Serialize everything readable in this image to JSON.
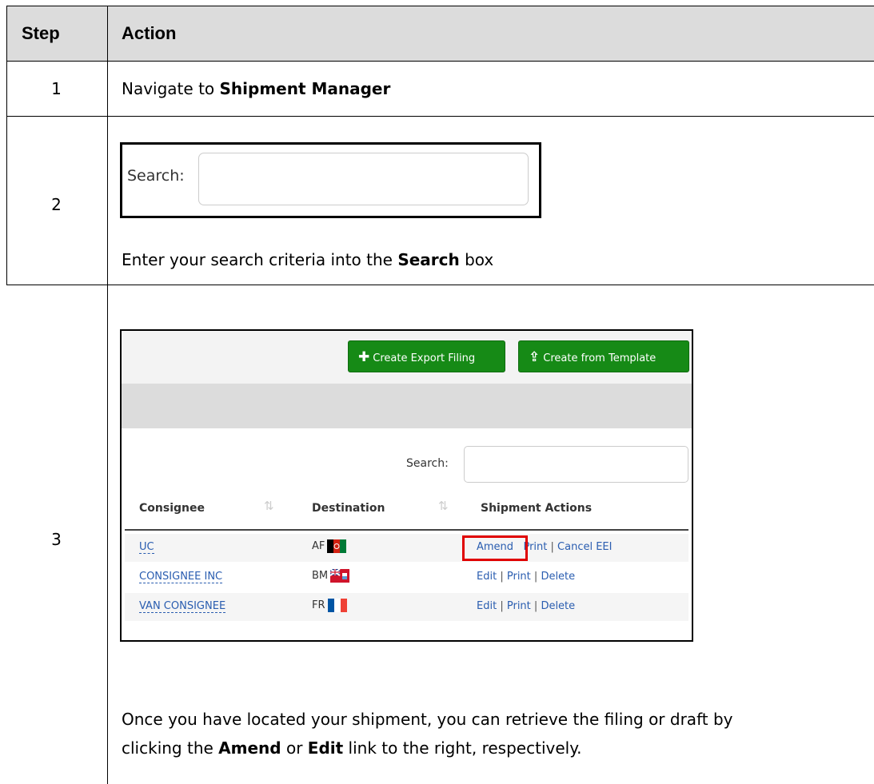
{
  "table": {
    "header": {
      "step": "Step",
      "action": "Action"
    },
    "rows": [
      {
        "num": "1",
        "text_before": "Navigate to ",
        "bold": "Shipment Manager"
      },
      {
        "num": "2",
        "text_before": "Enter your search criteria into the ",
        "bold": "Search",
        "text_after": " box"
      },
      {
        "num": "3",
        "text_before": "Once you have located your shipment, you can retrieve the filing or draft by",
        "line2_before": "clicking the ",
        "bold1": "Amend",
        "mid": " or ",
        "bold2": "Edit",
        "line2_after": " link to the right, respectively."
      }
    ]
  },
  "search_snippet": {
    "label": "Search:",
    "value": ""
  },
  "app": {
    "buttons": {
      "create_export_filing": "Create Export Filing",
      "create_from_template": "Create from Template"
    },
    "search_label": "Search:",
    "columns": {
      "consignee": "Consignee",
      "destination": "Destination",
      "actions": "Shipment Actions"
    },
    "rows": [
      {
        "consignee": "UC",
        "country": "AF",
        "flag": "afghanistan-flag",
        "a1": "Amend",
        "a2": "Print",
        "a3": "Cancel EEI"
      },
      {
        "consignee": "CONSIGNEE INC",
        "country": "BM",
        "flag": "bermuda-flag",
        "a1": "Edit",
        "a2": "Print",
        "a3": "Delete"
      },
      {
        "consignee": "VAN CONSIGNEE",
        "country": "FR",
        "flag": "france-flag",
        "a1": "Edit",
        "a2": "Print",
        "a3": "Delete"
      }
    ],
    "highlight_color": "#e00000",
    "button_color": "#168a16",
    "link_color": "#2a5db0"
  }
}
